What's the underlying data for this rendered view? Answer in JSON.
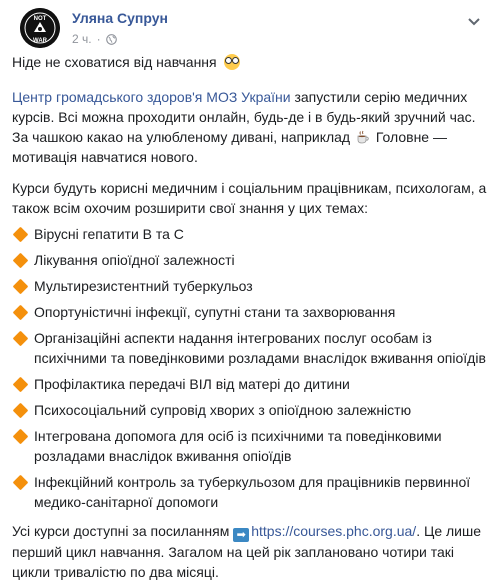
{
  "post": {
    "author": "Уляна Супрун",
    "time": "2 ч.",
    "separator": "·",
    "avatar": {
      "line1": "NOT",
      "line2": "WAR"
    },
    "intro": "Ніде не сховатися від навчання",
    "p2_link": "Центр громадського здоров'я МОЗ України",
    "p2_rest": " запустили серію медичних курсів. Всі можна проходити онлайн, будь-де і в будь-який зручний час. За чашкою какао на улюбленому дивані, наприклад",
    "p2_tail": " Головне — мотивація навчатися нового.",
    "p3": "Курси будуть корисні медичним і соціальним працівникам, психологам, а також всім охочим розширити свої знання у цих темах:",
    "topics": [
      "Вірусні гепатити В та С",
      "Лікування опіоїдної залежності",
      "Мультирезистентний туберкульоз",
      "Опортуністичні інфекції, супутні стани та захворювання",
      "Організаційні аспекти надання інтегрованих послуг особам із психічними та поведінковими розладами внаслідок вживання опіоїдів",
      "Профілактика передачі ВІЛ від матері до дитини",
      "Психосоціальний супровід хворих з опіоїдною залежністю",
      "Інтегрована допомога для осіб із психічними та поведінковими розладами внаслідок вживання опіоїдів",
      "Інфекційний контроль за туберкульозом для працівників первинної медико-санітарної допомоги"
    ],
    "final_pre": "Усі курси доступні за посиланням ",
    "final_link": "https://courses.phc.org.ua/",
    "final_post": ". Це лише перший цикл навчання. Загалом на цей рік заплановано чотири такі цикли тривалістю по два місяці."
  },
  "icons": {
    "globe": "globe-icon",
    "chevron": "chevron-down-icon",
    "bullet": "orange-diamond-icon",
    "nerd": "nerd-face-emoji-icon",
    "cup": "hot-beverage-emoji-icon",
    "arrow": "right-arrow-emoji-icon"
  },
  "colors": {
    "link": "#385898",
    "meta": "#90949c",
    "text": "#1c1e21",
    "bullet": "#f4900c"
  }
}
